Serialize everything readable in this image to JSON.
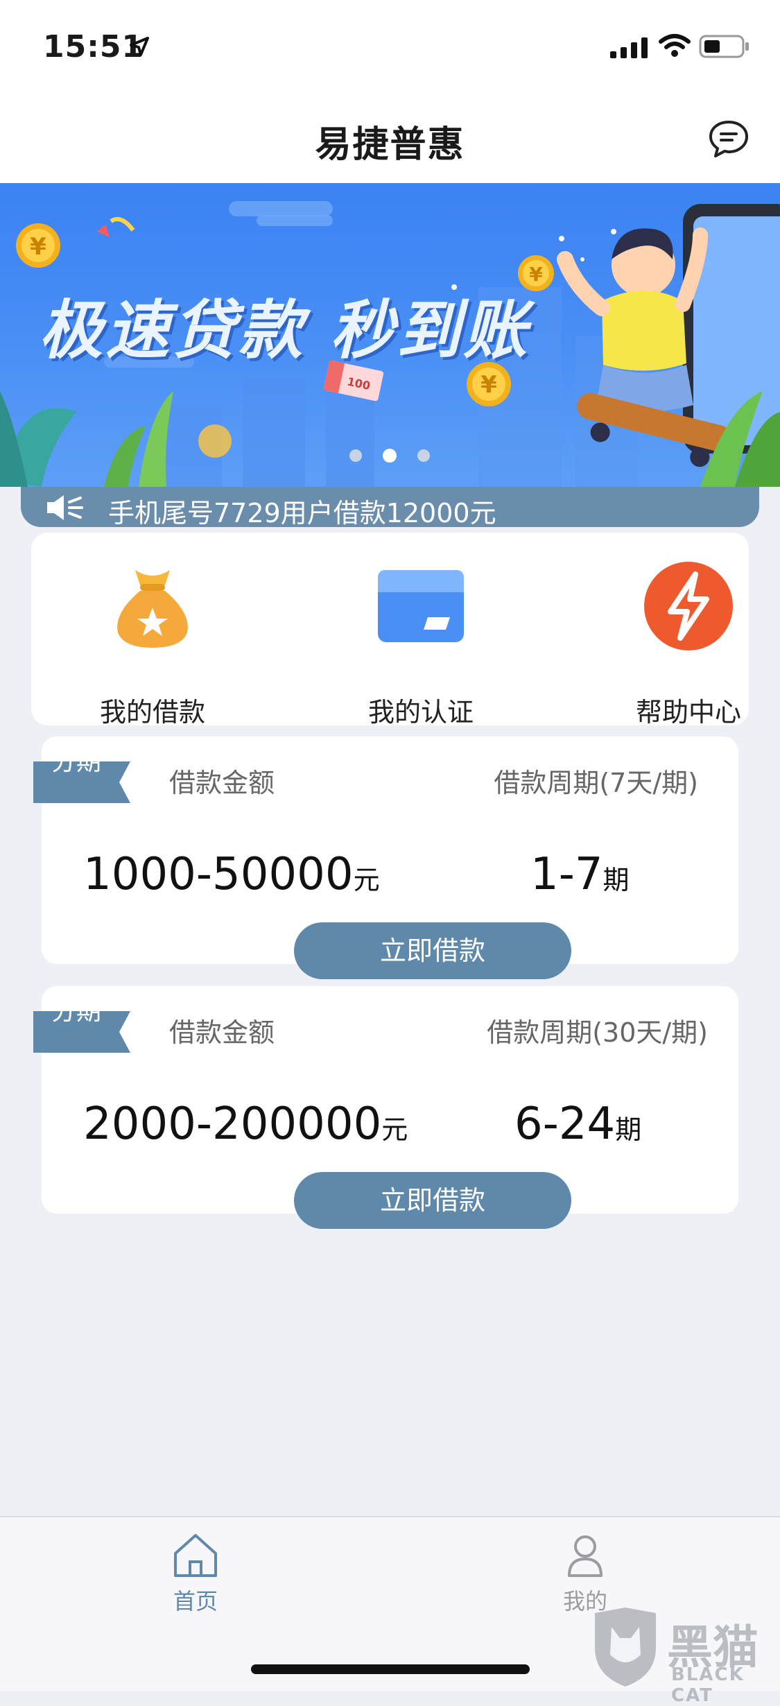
{
  "status_bar": {
    "time": "15:51"
  },
  "header": {
    "title": "易捷普惠"
  },
  "banner": {
    "slogan": "极速贷款 秒到账",
    "bill_value": "100",
    "coin_symbol": "¥"
  },
  "ticker": {
    "text": "手机尾号7729用户借款12000元"
  },
  "quick_menu": [
    {
      "label": "我的借款",
      "icon": "money-bag-icon"
    },
    {
      "label": "我的认证",
      "icon": "card-icon"
    },
    {
      "label": "帮助中心",
      "icon": "lightning-icon"
    }
  ],
  "loans": [
    {
      "tag": "分期",
      "amount_label": "借款金额",
      "period_label": "借款周期(7天/期)",
      "amount_value": "1000-50000",
      "amount_unit": "元",
      "period_value": "1-7",
      "period_unit": "期",
      "button": "立即借款"
    },
    {
      "tag": "分期",
      "amount_label": "借款金额",
      "period_label": "借款周期(30天/期)",
      "amount_value": "2000-200000",
      "amount_unit": "元",
      "period_value": "6-24",
      "period_unit": "期",
      "button": "立即借款"
    }
  ],
  "tab_bar": {
    "home": "首页",
    "mine": "我的",
    "active_color": "#5e89aa",
    "inactive_color": "#9a9ca2"
  },
  "watermark": {
    "brand": "黑猫",
    "brand_en": "BLACK CAT"
  }
}
